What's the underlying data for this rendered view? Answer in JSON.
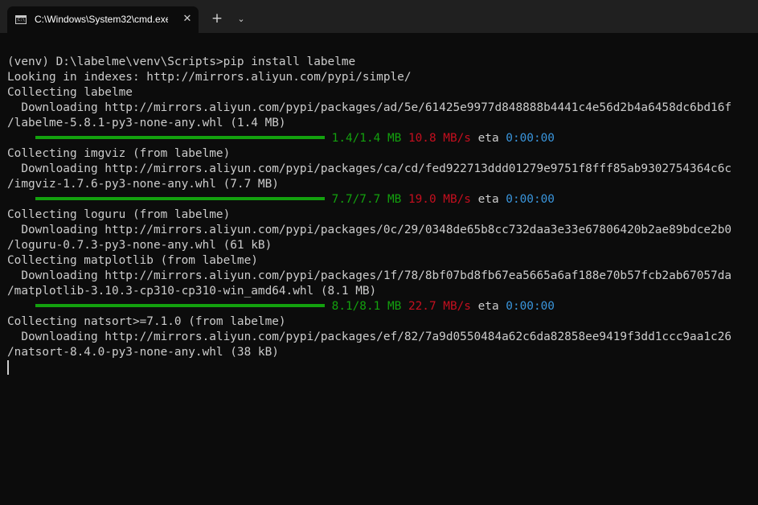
{
  "tab": {
    "title": "C:\\Windows\\System32\\cmd.exe",
    "close": "✕"
  },
  "toolbar": {
    "new_tab": "+",
    "dropdown": "⌄"
  },
  "terminal": {
    "lines": [
      "(venv) D:\\labelme\\venv\\Scripts>pip install labelme",
      "Looking in indexes: http://mirrors.aliyun.com/pypi/simple/",
      "Collecting labelme",
      "  Downloading http://mirrors.aliyun.com/pypi/packages/ad/5e/61425e9977d848888b4441c4e56d2b4a6458dc6bd16f",
      "/labelme-5.8.1-py3-none-any.whl (1.4 MB)",
      "",
      "Collecting imgviz (from labelme)",
      "  Downloading http://mirrors.aliyun.com/pypi/packages/ca/cd/fed922713ddd01279e9751f8fff85ab9302754364c6c",
      "/imgviz-1.7.6-py3-none-any.whl (7.7 MB)",
      "",
      "Collecting loguru (from labelme)",
      "  Downloading http://mirrors.aliyun.com/pypi/packages/0c/29/0348de65b8cc732daa3e33e67806420b2ae89bdce2b0",
      "/loguru-0.7.3-py3-none-any.whl (61 kB)",
      "Collecting matplotlib (from labelme)",
      "  Downloading http://mirrors.aliyun.com/pypi/packages/1f/78/8bf07bd8fb67ea5665a6af188e70b57fcb2ab67057da",
      "/matplotlib-3.10.3-cp310-cp310-win_amd64.whl (8.1 MB)",
      "",
      "Collecting natsort>=7.1.0 (from labelme)",
      "  Downloading http://mirrors.aliyun.com/pypi/packages/ef/82/7a9d0550484a62c6da82858ee9419f3dd1ccc9aa1c26",
      "/natsort-8.4.0-py3-none-any.whl (38 kB)"
    ],
    "progress": [
      {
        "size": "1.4/1.4 MB",
        "speed": "10.8 MB/s",
        "eta_label": "eta",
        "eta": "0:00:00",
        "fraction": 1.0
      },
      {
        "size": "7.7/7.7 MB",
        "speed": "19.0 MB/s",
        "eta_label": "eta",
        "eta": "0:00:00",
        "fraction": 1.0
      },
      {
        "size": "8.1/8.1 MB",
        "speed": "22.7 MB/s",
        "eta_label": "eta",
        "eta": "0:00:00",
        "fraction": 1.0
      }
    ]
  },
  "colors": {
    "background": "#0c0c0c",
    "text": "#cccccc",
    "progress_green": "#13a10e",
    "speed_red": "#c50f1f",
    "eta_cyan": "#3a96dd"
  }
}
